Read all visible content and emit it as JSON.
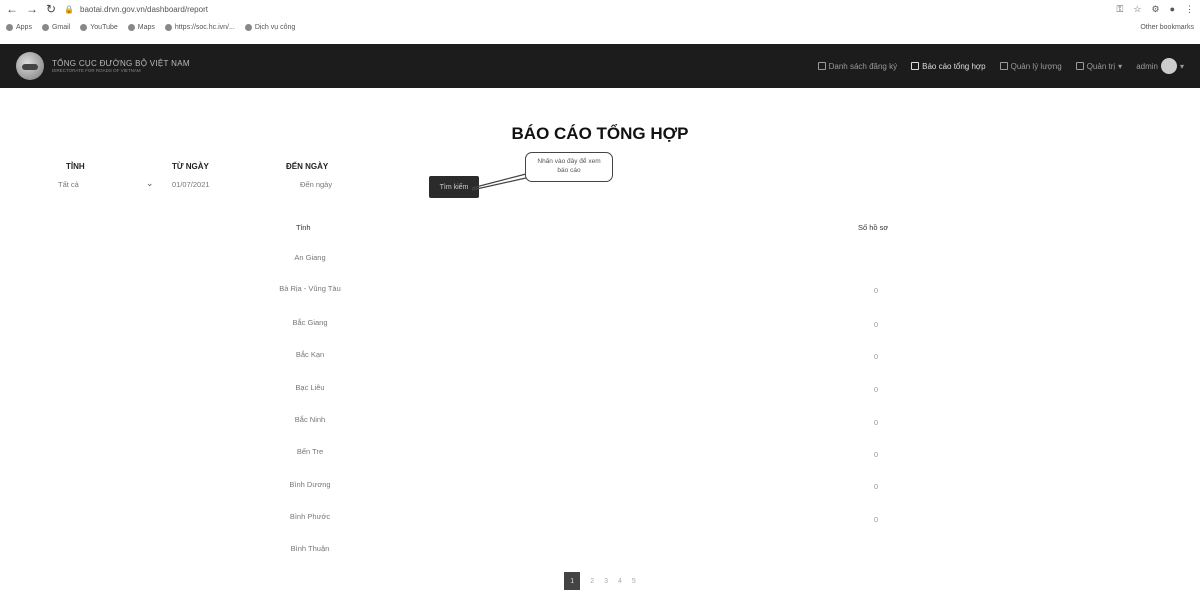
{
  "browser": {
    "url": "baotai.drvn.gov.vn/dashboard/report",
    "bookmarks": [
      "Apps",
      "Gmail",
      "YouTube",
      "Maps",
      "https://soc.hc.ivn/...",
      "Dịch vụ công"
    ],
    "other_bookmarks": "Other bookmarks"
  },
  "navbar": {
    "brand_title": "TỔNG CỤC ĐƯỜNG BỘ VIỆT NAM",
    "brand_subtitle": "DIRECTORATE FOR ROADS OF VIETNAM",
    "menu": [
      {
        "label": "Danh sách đăng ký",
        "active": false
      },
      {
        "label": "Báo cáo tổng hợp",
        "active": true
      },
      {
        "label": "Quản lý lượng",
        "active": false
      },
      {
        "label": "Quản trị",
        "active": false
      }
    ],
    "user": "admin"
  },
  "page": {
    "title": "BÁO CÁO TỔNG HỢP",
    "filters": {
      "province_label": "TỈNH",
      "province_value": "Tất cả",
      "from_label": "TỪ NGÀY",
      "from_value": "01/07/2021",
      "to_label": "ĐẾN NGÀY",
      "to_value": "Đến ngày"
    },
    "report_button": "Tìm kiếm",
    "tooltip": "Nhấn vào đây để xem báo cáo"
  },
  "table": {
    "col_province": "Tỉnh",
    "col_count": "Số hồ sơ",
    "rows": [
      {
        "province": "An Giang",
        "count": ""
      },
      {
        "province": "Bà Rịa - Vũng Tàu",
        "count": "0"
      },
      {
        "province": "Bắc Giang",
        "count": "0"
      },
      {
        "province": "Bắc Kạn",
        "count": "0"
      },
      {
        "province": "Bạc Liêu",
        "count": "0"
      },
      {
        "province": "Bắc Ninh",
        "count": "0"
      },
      {
        "province": "Bến Tre",
        "count": "0"
      },
      {
        "province": "Bình Dương",
        "count": "0"
      },
      {
        "province": "Bình Phước",
        "count": "0"
      },
      {
        "province": "Bình Thuận",
        "count": ""
      }
    ]
  },
  "pagination": {
    "pages": [
      "1",
      "2",
      "3",
      "4",
      "5"
    ],
    "active": "1"
  }
}
